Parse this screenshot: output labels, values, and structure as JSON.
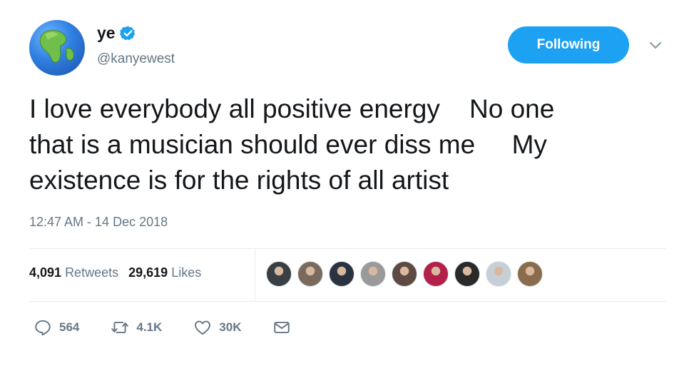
{
  "user": {
    "display_name": "ye",
    "handle": "@kanyewest",
    "verified": true
  },
  "follow_button": {
    "label": "Following"
  },
  "tweet": {
    "lines": [
      "I love everybody all positive energy    No one",
      "that is a musician should ever diss me     My",
      "existence is for the rights of all artist"
    ],
    "timestamp": "12:47 AM - 14 Dec 2018"
  },
  "stats": {
    "retweets_count": "4,091",
    "retweets_label": "Retweets",
    "likes_count": "29,619",
    "likes_label": "Likes"
  },
  "likers": [
    {
      "color": "#3a3f44"
    },
    {
      "color": "#7a6a5e"
    },
    {
      "color": "#2b3240"
    },
    {
      "color": "#9a9a9a"
    },
    {
      "color": "#5c4a43"
    },
    {
      "color": "#b3204a"
    },
    {
      "color": "#2a2a2a"
    },
    {
      "color": "#c7cfd6"
    },
    {
      "color": "#8a6b4c"
    }
  ],
  "actions": {
    "reply_count": "564",
    "retweet_count": "4.1K",
    "like_count": "30K"
  },
  "colors": {
    "accent": "#1da1f2",
    "secondary_text": "#657786",
    "primary_text": "#14171a"
  },
  "icons": [
    "globe-avatar",
    "verified-badge-icon",
    "chevron-down-icon",
    "reply-icon",
    "retweet-icon",
    "heart-icon",
    "envelope-icon"
  ]
}
